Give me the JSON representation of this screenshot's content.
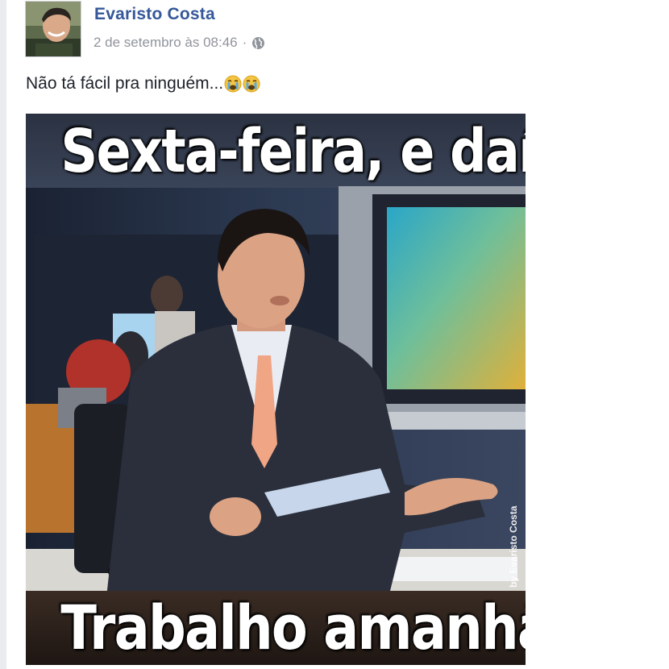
{
  "post": {
    "author": "Evaristo Costa",
    "timestamp": "2 de setembro às 08:46",
    "separator": "·",
    "privacy_icon": "globe-icon",
    "text": "Não tá fácil pra ninguém...",
    "emoji": [
      "crying-face-emoji",
      "crying-face-emoji"
    ]
  },
  "meme": {
    "top_caption": "Sexta-feira, e daí?",
    "bottom_caption": "Trabalho amanhã.",
    "watermark": "by Evaristo Costa"
  },
  "colors": {
    "author_link": "#365899",
    "meta_text": "#90949c",
    "body_text": "#1d2129",
    "page_edge": "#e9ebee"
  }
}
